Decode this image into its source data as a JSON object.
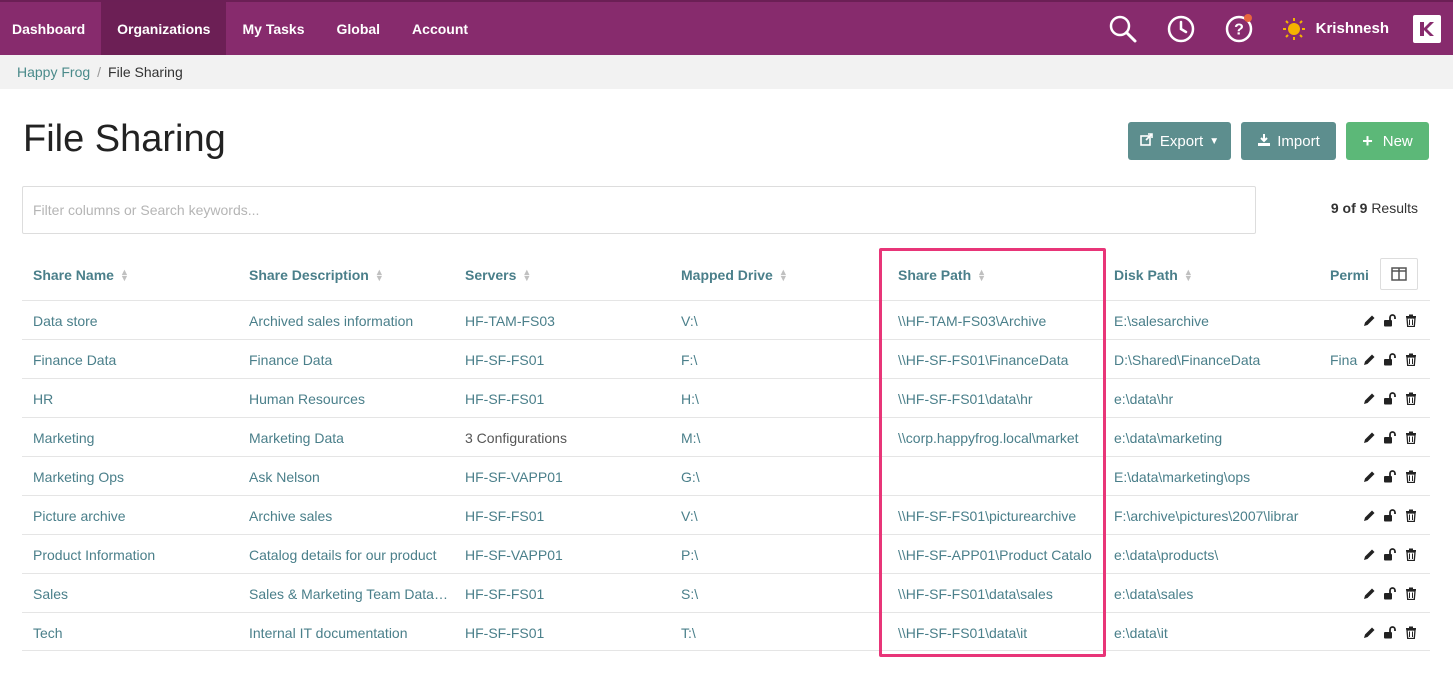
{
  "nav": {
    "items": [
      "Dashboard",
      "Organizations",
      "My Tasks",
      "Global",
      "Account"
    ],
    "active": "Organizations",
    "user": "Krishnesh",
    "icons": [
      "search-icon",
      "clock-icon",
      "help-icon",
      "user-avatar-icon",
      "brand-logo-icon"
    ]
  },
  "breadcrumb": {
    "parent": "Happy Frog",
    "separator": "/",
    "current": "File Sharing"
  },
  "page": {
    "title": "File Sharing"
  },
  "toolbar": {
    "export_label": "Export",
    "import_label": "Import",
    "new_label": "New"
  },
  "search": {
    "placeholder": "Filter columns or Search keywords...",
    "value": ""
  },
  "results": {
    "count": "9 of 9",
    "suffix": "Results"
  },
  "table": {
    "columns": [
      "Share Name",
      "Share Description",
      "Servers",
      "Mapped Drive",
      "Share Path",
      "Disk Path",
      "Permi"
    ],
    "rows": [
      {
        "name": "Data store",
        "desc": "Archived sales information",
        "servers": "HF-TAM-FS03",
        "drive": "V:\\",
        "share": "\\\\HF-TAM-FS03\\Archive",
        "disk": "E:\\salesarchive",
        "perm": ""
      },
      {
        "name": "Finance Data",
        "desc": "Finance Data",
        "servers": "HF-SF-FS01",
        "drive": "F:\\",
        "share": "\\\\HF-SF-FS01\\FinanceData",
        "disk": "D:\\Shared\\FinanceData",
        "perm": "Fina"
      },
      {
        "name": "HR",
        "desc": "Human Resources",
        "servers": "HF-SF-FS01",
        "drive": "H:\\",
        "share": "\\\\HF-SF-FS01\\data\\hr",
        "disk": "e:\\data\\hr",
        "perm": ""
      },
      {
        "name": "Marketing",
        "desc": "Marketing Data",
        "servers": "3 Configurations",
        "drive": "M:\\",
        "share": "\\\\corp.happyfrog.local\\market",
        "disk": "e:\\data\\marketing",
        "perm": ""
      },
      {
        "name": "Marketing Ops",
        "desc": "Ask Nelson",
        "servers": "HF-SF-VAPP01",
        "drive": "G:\\",
        "share": "",
        "disk": "E:\\data\\marketing\\ops",
        "perm": ""
      },
      {
        "name": "Picture archive",
        "desc": "Archive sales",
        "servers": "HF-SF-FS01",
        "drive": "V:\\",
        "share": "\\\\HF-SF-FS01\\picturearchive",
        "disk": "F:\\archive\\pictures\\2007\\librar",
        "perm": ""
      },
      {
        "name": "Product Information",
        "desc": "Catalog details for our product",
        "servers": "HF-SF-VAPP01",
        "drive": "P:\\",
        "share": "\\\\HF-SF-APP01\\Product Catalo",
        "disk": "e:\\data\\products\\",
        "perm": ""
      },
      {
        "name": "Sales",
        "desc": "Sales & Marketing Team Data…",
        "servers": "HF-SF-FS01",
        "drive": "S:\\",
        "share": "\\\\HF-SF-FS01\\data\\sales",
        "disk": "e:\\data\\sales",
        "perm": ""
      },
      {
        "name": "Tech",
        "desc": "Internal IT documentation",
        "servers": "HF-SF-FS01",
        "drive": "T:\\",
        "share": "\\\\HF-SF-FS01\\data\\it",
        "disk": "e:\\data\\it",
        "perm": ""
      }
    ]
  },
  "colors": {
    "nav_bg": "#872b6d",
    "nav_active": "#6c1f55",
    "teal_button": "#5d8e8e",
    "green_button": "#5cb878",
    "link": "#4a7f8a",
    "highlight": "#e83578"
  }
}
